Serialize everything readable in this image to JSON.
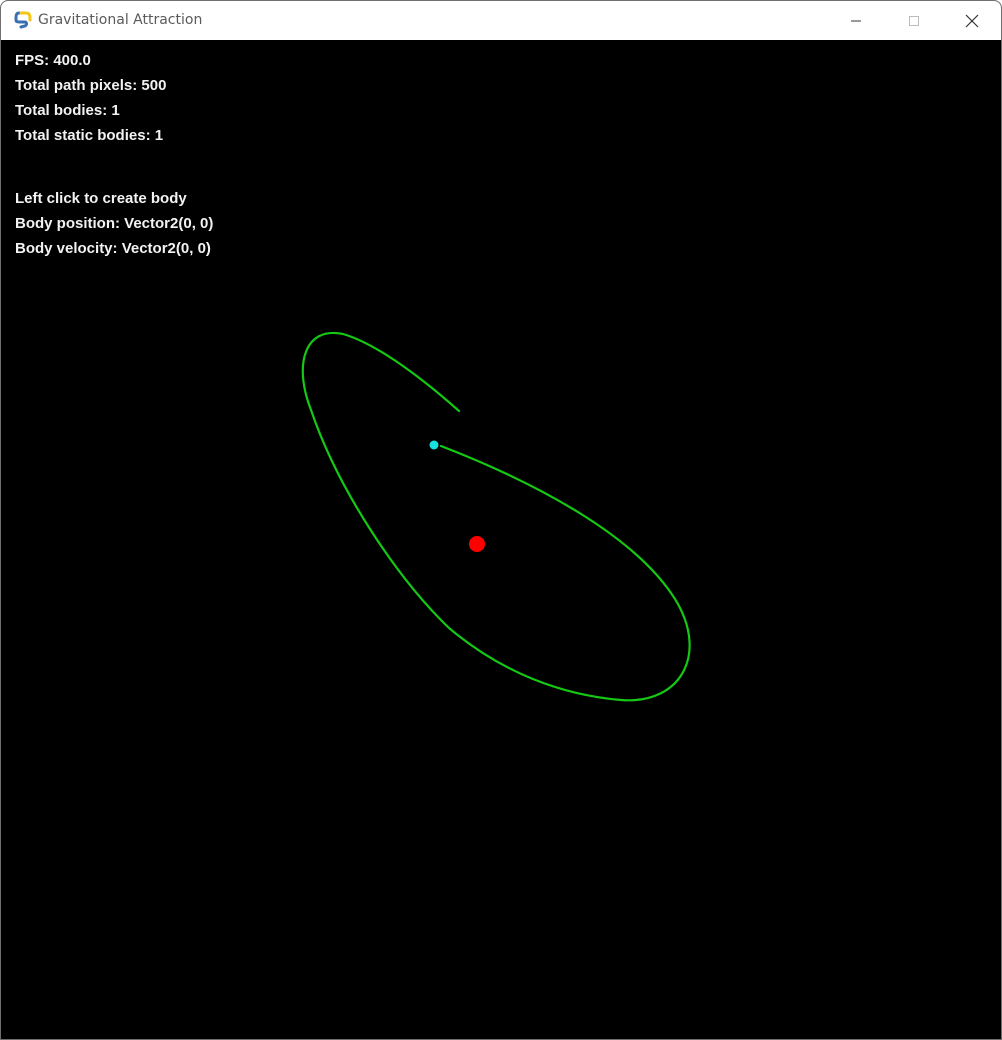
{
  "window": {
    "title": "Gravitational Attraction",
    "app_icon": "pygame-snake-icon",
    "controls": [
      "minimize-icon",
      "maximize-icon",
      "close-icon"
    ]
  },
  "hud": {
    "fps": "FPS: 400.0",
    "path_pixels": "Total path pixels: 500",
    "bodies": "Total bodies: 1",
    "static_bodies": "Total static bodies: 1",
    "instruction": "Left click to create body",
    "body_position": "Body position: Vector2(0, 0)",
    "body_velocity": "Body velocity: Vector2(0, 0)"
  },
  "colors": {
    "background": "#000000",
    "hud_text": "#f2f2f2",
    "orbit_path": "#14c814",
    "orbiting_body": "#19e0e0",
    "static_body": "#ff0000"
  }
}
